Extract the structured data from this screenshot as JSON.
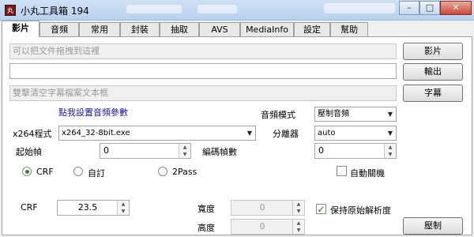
{
  "window": {
    "icon_text": "丸",
    "title": "小丸工具箱 194",
    "controls": {
      "minimize": "–",
      "maximize": "□",
      "close": "✕"
    }
  },
  "tabs": [
    "影片",
    "音頻",
    "常用",
    "封裝",
    "抽取",
    "AVS",
    "MediaInfo",
    "設定",
    "幫助"
  ],
  "video": {
    "input_placeholder": "可以把文件拖拽到這裡",
    "output_value": "",
    "subtitle_placeholder": "雙擊清空字幕檔案文本框",
    "btn_video": "影片",
    "btn_output": "輸出",
    "btn_subtitle": "字幕",
    "audio_params_link": "點我設置音頻參數",
    "audio_mode_label": "音頻模式",
    "audio_mode_value": "壓制音頻",
    "x264_label": "x264程式",
    "x264_value": "x264_32-8bit.exe",
    "splitter_label": "分離器",
    "splitter_value": "auto",
    "start_frame_label": "起始幀",
    "start_frame_value": "0",
    "encode_frames_label": "編碼幀數",
    "encode_frames_value": "0",
    "radio_crf": "CRF",
    "radio_custom": "自訂",
    "radio_2pass": "2Pass",
    "auto_shutdown_label": "自動關機",
    "crf_label": "CRF",
    "crf_value": "23.5",
    "width_label": "寬度",
    "width_value": "0",
    "height_label": "高度",
    "height_value": "0",
    "keep_res_label": "保持原始解析度",
    "btn_encode": "壓制"
  },
  "colors": {
    "link": "#1a1aa6",
    "title_bar": "#cfe0f4"
  }
}
